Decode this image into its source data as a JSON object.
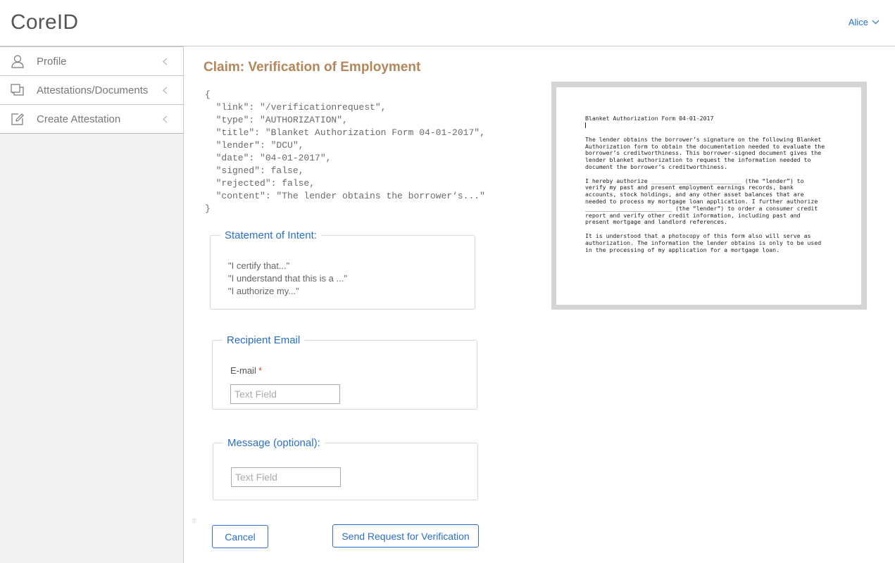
{
  "app": {
    "title": "CoreID",
    "user": "Alice"
  },
  "sidebar": {
    "items": [
      {
        "label": "Profile",
        "icon": "user-icon"
      },
      {
        "label": "Attestations/Documents",
        "icon": "documents-icon"
      },
      {
        "label": "Create Attestation",
        "icon": "edit-icon"
      }
    ]
  },
  "main": {
    "title": "Claim: Verification of Employment",
    "json_lines": [
      "{",
      "  \"link\": \"/verificationrequest\",",
      "  \"type\": \"AUTHORIZATION\",",
      "  \"title\": \"Blanket Authorization Form 04-01-2017\",",
      "  \"lender\": \"DCU\",",
      "  \"date\": \"04-01-2017\",",
      "  \"signed\": false,",
      "  \"rejected\": false,",
      "  \"content\": \"The lender obtains the borrower‘s...\"",
      "}"
    ],
    "intent": {
      "legend": "Statement of Intent:",
      "lines": [
        "\"I certify that...\"",
        "\"I understand that this is a ...\"",
        "\"I authorize my...\""
      ]
    },
    "recipient": {
      "legend": "Recipient Email",
      "label": "E-mail",
      "required": "*",
      "placeholder": "Text Field",
      "value": ""
    },
    "message": {
      "legend": "Message (optional):",
      "placeholder": "Text Field",
      "value": ""
    },
    "buttons": {
      "cancel": "Cancel",
      "send": "Send Request for Verification"
    }
  },
  "preview": {
    "title": "Blanket Authorization Form 04-01-2017",
    "paragraphs": [
      "The lender obtains the borrower’s signature on the following Blanket\nAuthorization form to obtain the documentation needed to evaluate the\nborrower’s creditworthiness. This borrower-signed document gives the\nlender blanket authorization to request the information needed to\ndocument the borrower’s creditworthiness.",
      "I hereby authorize __________________________ (the “lender”) to\nverify my past and present employment earnings records, bank\naccounts, stock holdings, and any other asset balances that are\nneeded to process my mortgage loan application. I further authorize\n_________________________ (the “lender”) to order a consumer credit\nreport and verify other credit information, including past and\npresent mortgage and landlord references.",
      "It is understood that a photocopy of this form also will serve as\nauthorization. The information the lender obtains is only to be used\nin the processing of my application for a mortgage loan."
    ]
  },
  "colors": {
    "accent": "#2a6fc9",
    "title": "#b5865a",
    "required": "#d04a3a"
  }
}
